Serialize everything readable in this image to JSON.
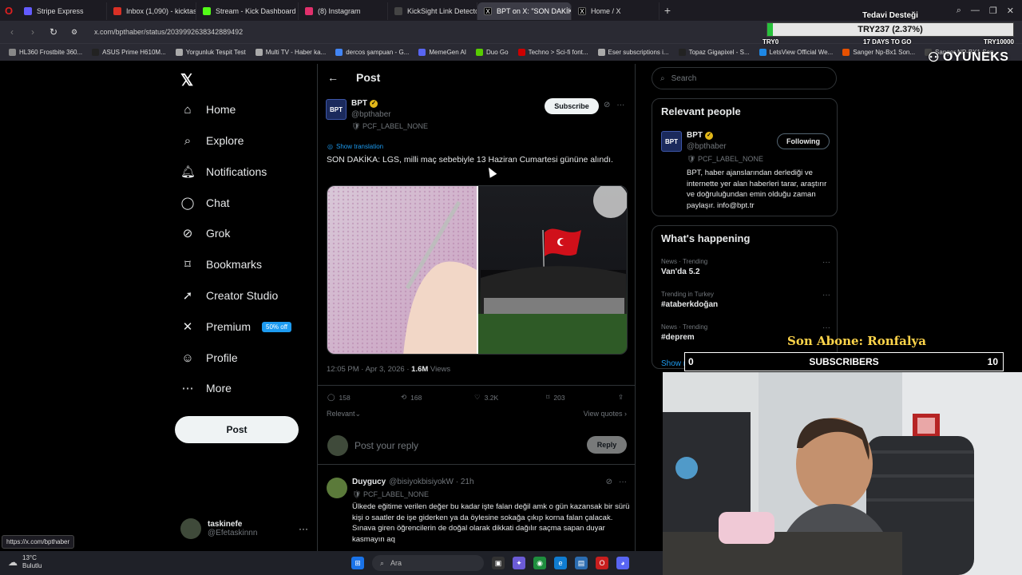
{
  "browser": {
    "tabs": [
      {
        "label": "Stripe Express",
        "color": "#635bff",
        "active": false
      },
      {
        "label": "Inbox (1,090) - kicktaskin",
        "color": "#d93025",
        "active": false
      },
      {
        "label": "Stream - Kick Dashboard",
        "color": "#53fc18",
        "active": false
      },
      {
        "label": "(8) Instagram",
        "color": "#e1306c",
        "active": false
      },
      {
        "label": "KickSight Link Detector",
        "color": "#444",
        "active": false
      },
      {
        "label": "BPT on X: \"SON DAKİKA: l",
        "color": "#000",
        "active": true
      },
      {
        "label": "Home / X",
        "color": "#000",
        "active": false
      }
    ],
    "url": "x.com/bpthaber/status/2039992638342889492",
    "bookmarks": [
      {
        "label": "HL360 Frostbite 360...",
        "color": "#888"
      },
      {
        "label": "ASUS Prime H610M...",
        "color": "#222"
      },
      {
        "label": "Yorgunluk Tespit Test",
        "color": "#aaa"
      },
      {
        "label": "Multi TV - Haber ka...",
        "color": "#aaa"
      },
      {
        "label": "dercos şampuan - G...",
        "color": "#4285f4"
      },
      {
        "label": "MemeGen AI",
        "color": "#5865f2"
      },
      {
        "label": "Duo Go",
        "color": "#58cc02"
      },
      {
        "label": "Techno > Sci-fi font...",
        "color": "#c00"
      },
      {
        "label": "Eser subscriptions i...",
        "color": "#aaa"
      },
      {
        "label": "Topaz Gigapixel - S...",
        "color": "#222"
      },
      {
        "label": "LetsView Official We...",
        "color": "#1e88e5"
      },
      {
        "label": "Sanger Np-Bx1 Son...",
        "color": "#e65100"
      },
      {
        "label": "Sanger NP-BX1 Son...",
        "color": "#444"
      }
    ],
    "status_url": "https://x.com/bpthaber"
  },
  "nav": {
    "items": [
      "Home",
      "Explore",
      "Notifications",
      "Chat",
      "Grok",
      "Bookmarks",
      "Creator Studio",
      "Premium",
      "Profile",
      "More"
    ],
    "premium_badge": "50% off",
    "post_button": "Post",
    "account": {
      "name": "taskinefe",
      "handle": "@Efetaskinnn"
    }
  },
  "post": {
    "header_title": "Post",
    "author": {
      "name": "BPT",
      "handle": "@bpthaber",
      "label": "PCF_LABEL_NONE",
      "logo_text": "BPT"
    },
    "subscribe": "Subscribe",
    "show_translation": "Show translation",
    "text": "SON DAKİKA: LGS, milli maç sebebiyle 13 Haziran Cumartesi gününe alındı.",
    "time": "12:05 PM · Apr 3, 2026 · ",
    "views_count": "1.6M",
    "views_label": "Views",
    "stats": {
      "replies": "158",
      "reposts": "168",
      "likes": "3.2K",
      "bookmarks": "203"
    },
    "sort": "Relevant",
    "view_quotes": "View quotes",
    "reply_placeholder": "Post your reply",
    "reply_button": "Reply"
  },
  "comment": {
    "name": "Duygucy",
    "meta": "@bisiyokbisiyokW · 21h",
    "label": "PCF_LABEL_NONE",
    "text": "Ülkede eğitime verilen değer bu kadar işte falan değil amk o gün kazansak bir sürü kişi o saatler de işe giderken ya da öylesine sokağa çıkıp korna falan çalacak. Sınava giren öğrencilerin de doğal olarak dikkati dağılır saçma sapan duyar kasmayın aq"
  },
  "right": {
    "search_placeholder": "Search",
    "relevant_title": "Relevant people",
    "person": {
      "name": "BPT",
      "handle": "@bpthaber",
      "label": "PCF_LABEL_NONE",
      "bio": "BPT, haber ajanslarından derlediği ve internette yer alan haberleri tarar, araştırır ve doğruluğundan emin olduğu zaman paylaşır. info@bpt.tr",
      "follow": "Following"
    },
    "happening_title": "What's happening",
    "trends": [
      {
        "meta": "News · Trending",
        "name": "Van'da 5.2"
      },
      {
        "meta": "Trending in Turkey",
        "name": "#ataberkdoğan"
      },
      {
        "meta": "News · Trending",
        "name": "#deprem"
      }
    ],
    "show_more": "Show more"
  },
  "overlay": {
    "donation_title": "Tedavi Desteği",
    "donation_value": "TRY237 (2.37%)",
    "donation_fraction": 0.0237,
    "donation_start": "TRY0",
    "donation_days": "17 DAYS TO GO",
    "donation_goal": "TRY10000",
    "brand": "OYUNEKS",
    "son_abone": "Son Abone: Ronfalya",
    "subs_min": "0",
    "subs_label": "SUBSCRIBERS",
    "subs_max": "10"
  },
  "taskbar": {
    "temp": "13°C",
    "weather": "Bulutlu",
    "search": "Ara"
  },
  "colors": {
    "accent": "#1d9bf0",
    "background": "#000000",
    "text": "#e7e9ea",
    "muted": "#71767b",
    "verified": "#e2b719"
  }
}
